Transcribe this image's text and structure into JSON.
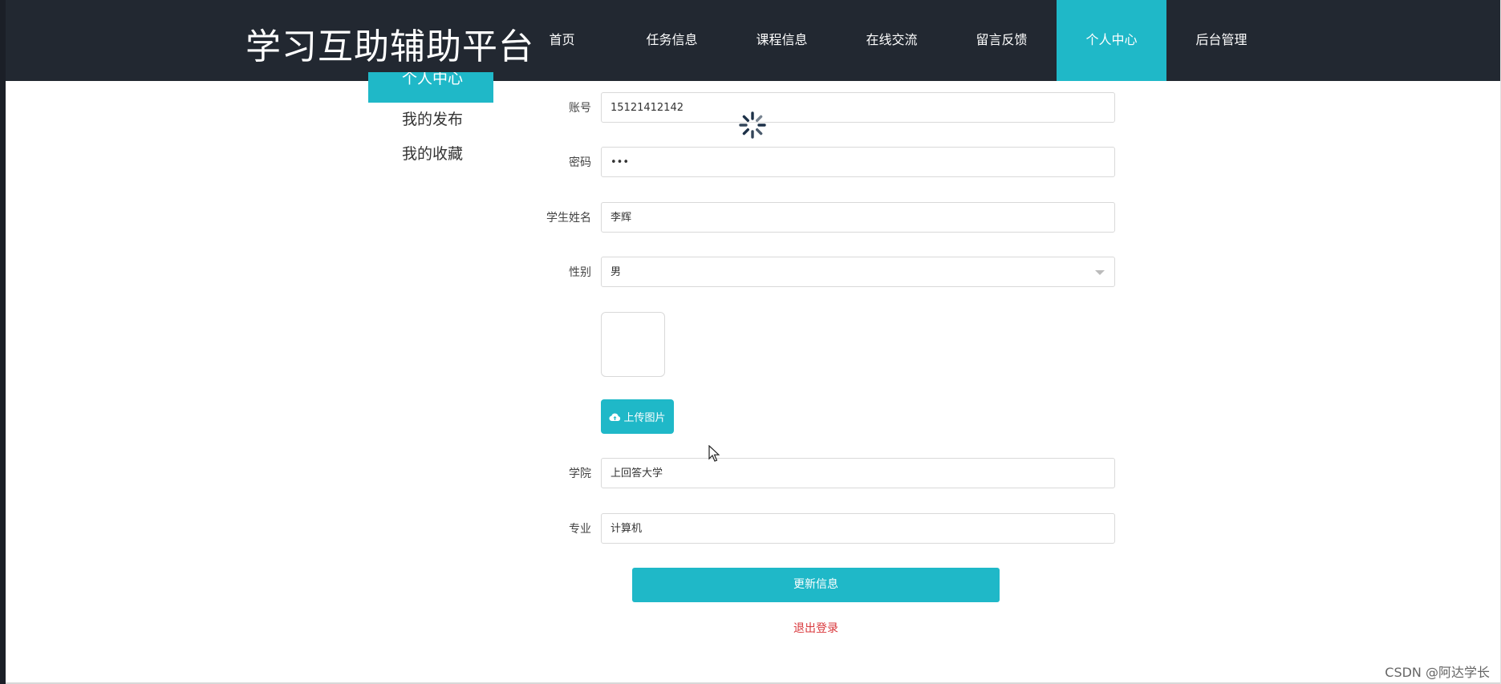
{
  "header": {
    "brand": "学习互助辅助平台",
    "nav": [
      "首页",
      "任务信息",
      "课程信息",
      "在线交流",
      "留言反馈",
      "个人中心",
      "后台管理"
    ],
    "active_index": 5
  },
  "side_menu": {
    "items": [
      "个人中心",
      "我的发布",
      "我的收藏"
    ]
  },
  "form": {
    "account": {
      "label": "账号",
      "value": "15121412142"
    },
    "password": {
      "label": "密码",
      "value": "•••"
    },
    "name": {
      "label": "学生姓名",
      "value": "李辉"
    },
    "gender": {
      "label": "性别",
      "value": "男"
    },
    "upload_label": "上传图片",
    "college": {
      "label": "学院",
      "value": "上回答大学"
    },
    "major": {
      "label": "专业",
      "value": "计算机"
    },
    "submit_label": "更新信息",
    "logout_label": "退出登录"
  },
  "watermark": "CSDN @阿达学长",
  "colors": {
    "header_bg": "#222831",
    "accent": "#1fb8c8",
    "danger": "#d9373b"
  },
  "icons": [
    "cloud-upload-icon",
    "loading-spinner-icon",
    "mouse-cursor-icon",
    "select-arrow-icon"
  ]
}
